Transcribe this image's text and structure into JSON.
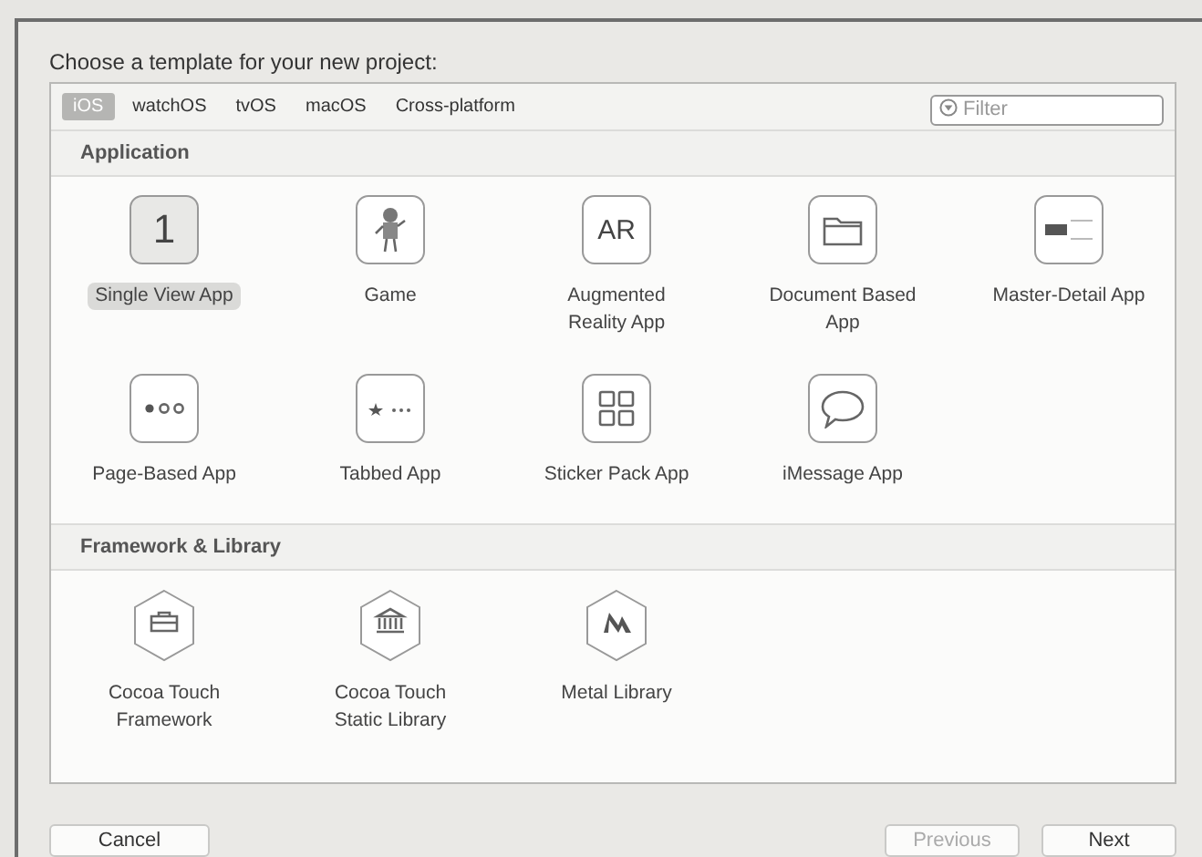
{
  "heading": "Choose a template for your new project:",
  "tabs": [
    {
      "label": "iOS",
      "selected": true
    },
    {
      "label": "watchOS",
      "selected": false
    },
    {
      "label": "tvOS",
      "selected": false
    },
    {
      "label": "macOS",
      "selected": false
    },
    {
      "label": "Cross-platform",
      "selected": false
    }
  ],
  "filter": {
    "placeholder": "Filter"
  },
  "sections": [
    {
      "title": "Application",
      "templates": [
        {
          "kind": "glyph",
          "glyph": "1",
          "label": "Single View App",
          "selected": true
        },
        {
          "kind": "game",
          "label": "Game",
          "selected": false
        },
        {
          "kind": "glyph",
          "glyph": "AR",
          "label": "Augmented Reality App",
          "selected": false
        },
        {
          "kind": "folder",
          "label": "Document Based App",
          "selected": false
        },
        {
          "kind": "master-detail",
          "label": "Master-Detail App",
          "selected": false
        },
        {
          "kind": "page-dots",
          "label": "Page-Based App",
          "selected": false
        },
        {
          "kind": "tabbed",
          "label": "Tabbed App",
          "selected": false
        },
        {
          "kind": "sticker-grid",
          "label": "Sticker Pack App",
          "selected": false
        },
        {
          "kind": "speech-bubble",
          "label": "iMessage App",
          "selected": false
        }
      ]
    },
    {
      "title": "Framework & Library",
      "templates": [
        {
          "kind": "hex-toolbox",
          "label": "Cocoa Touch Framework",
          "selected": false
        },
        {
          "kind": "hex-bank",
          "label": "Cocoa Touch Static Library",
          "selected": false
        },
        {
          "kind": "hex-metal",
          "label": "Metal Library",
          "selected": false
        }
      ]
    }
  ],
  "buttons": [
    {
      "label": "Cancel",
      "disabled": false
    },
    {
      "label": "Previous",
      "disabled": true
    },
    {
      "label": "Next",
      "disabled": false
    }
  ]
}
